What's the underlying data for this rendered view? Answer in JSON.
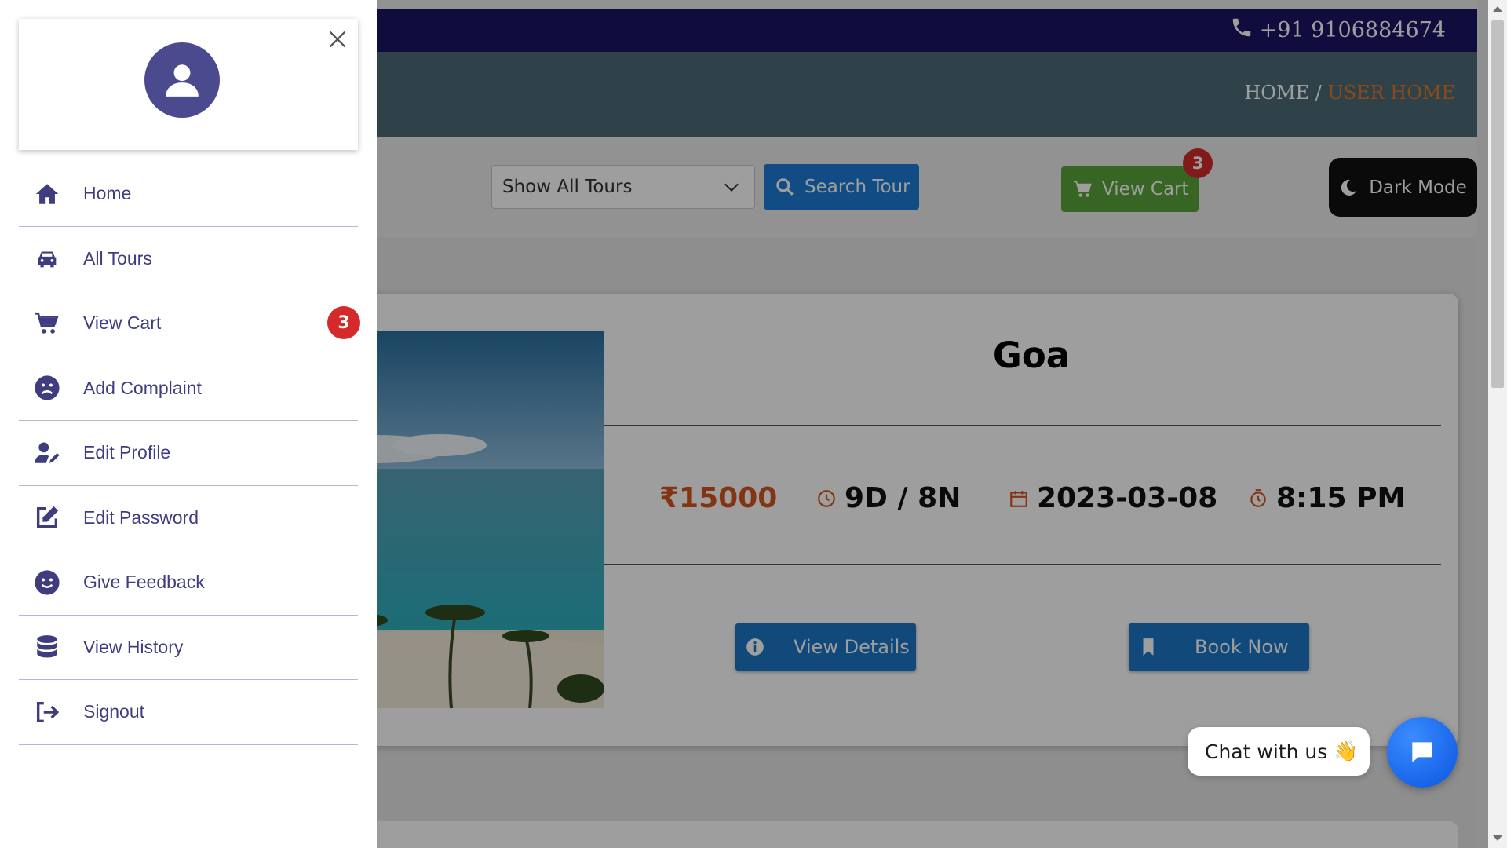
{
  "header": {
    "phone": "+91 9106884674",
    "breadcrumb_home": "HOME",
    "breadcrumb_sep": " / ",
    "breadcrumb_current": "USER HOME"
  },
  "toolbar": {
    "tour_select_value": "Show All Tours",
    "search_label": "Search Tour",
    "cart_label": "View Cart",
    "cart_count": "3",
    "dark_mode_label": "Dark Mode"
  },
  "tour_card": {
    "title": "Goa",
    "price": "₹15000",
    "duration": "9D / 8N",
    "date": "2023-03-08",
    "time": "8:15 PM",
    "details_label": "View Details",
    "book_label": "Book Now"
  },
  "chat": {
    "label": "Chat with us",
    "emoji": "👋"
  },
  "sidebar": {
    "items": [
      {
        "label": "Home",
        "icon": "home-icon"
      },
      {
        "label": "All Tours",
        "icon": "car-icon"
      },
      {
        "label": "View Cart",
        "icon": "cart-icon",
        "badge": "3"
      },
      {
        "label": "Add Complaint",
        "icon": "sad-face-icon"
      },
      {
        "label": "Edit Profile",
        "icon": "user-edit-icon"
      },
      {
        "label": "Edit Password",
        "icon": "edit-square-icon"
      },
      {
        "label": "Give Feedback",
        "icon": "smile-face-icon"
      },
      {
        "label": "View History",
        "icon": "database-icon"
      },
      {
        "label": "Signout",
        "icon": "signout-icon"
      }
    ]
  },
  "colors": {
    "sidebar_text": "#3f3d80",
    "accent_orange": "#e0762a",
    "badge_red": "#d42a2a",
    "primary_blue": "#1c76c5",
    "cart_green": "#5aa53a"
  }
}
